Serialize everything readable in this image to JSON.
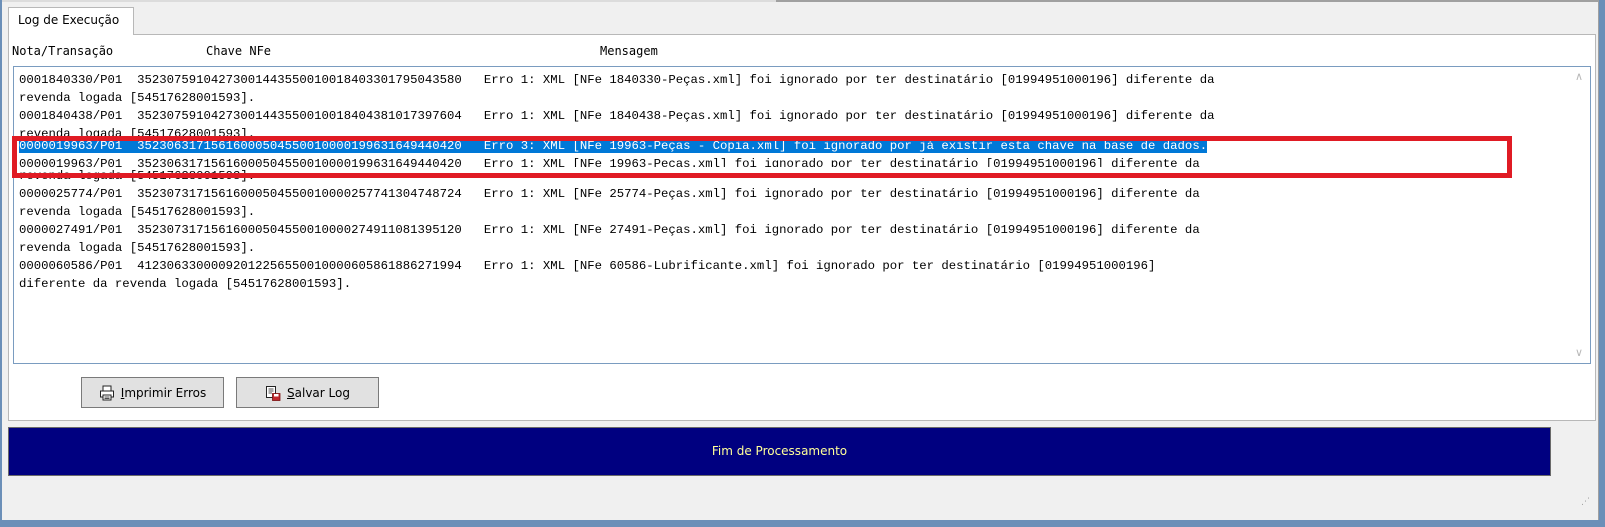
{
  "tab": {
    "label": "Log de Execução"
  },
  "columns": {
    "nota": "Nota/Transação",
    "chave": "Chave NFe",
    "mensagem": "Mensagem"
  },
  "log": {
    "lines": [
      {
        "text": "0001840330/P01  35230759104273001443550010018403301795043580   Erro 1: XML [NFe 1840330-Peças.xml] foi ignorado por ter destinatário [01994951000196] diferente da"
      },
      {
        "text": "revenda logada [54517628001593]."
      },
      {
        "text": "0001840438/P01  35230759104273001443550010018404381017397604   Erro 1: XML [NFe 1840438-Peças.xml] foi ignorado por ter destinatário [01994951000196] diferente da"
      },
      {
        "text": "revenda logada [54517628001593]."
      },
      {
        "text": "0000019963/P01  35230631715616000504550010000199631649440420   Erro 3: XML [NFe 19963-Peças - Copia.xml] foi ignorado por já existir esta chave na base de dados."
      },
      {
        "text": "0000019963/P01  35230631715616000504550010000199631649440420   Erro 1: XML [NFe 19963-Peças.xml] foi ignorado por ter destinatário [01994951000196] diferente da"
      },
      {
        "text": "revenda logada [54517628001593]."
      },
      {
        "text": "0000025774/P01  35230731715616000504550010000257741304748724   Erro 1: XML [NFe 25774-Peças.xml] foi ignorado por ter destinatário [01994951000196] diferente da"
      },
      {
        "text": "revenda logada [54517628001593]."
      },
      {
        "text": "0000027491/P01  35230731715616000504550010000274911081395120   Erro 1: XML [NFe 27491-Peças.xml] foi ignorado por ter destinatário [01994951000196] diferente da"
      },
      {
        "text": "revenda logada [54517628001593]."
      },
      {
        "text": "0000060586/P01  41230633000092012256550010000605861886271994   Erro 1: XML [NFe 60586-Lubrificante.xml] foi ignorado por ter destinatário [01994951000196]"
      },
      {
        "text": "diferente da revenda logada [54517628001593]."
      }
    ],
    "selected_index": 4
  },
  "buttons": {
    "print_label_prefix": "",
    "print_mnemonic": "I",
    "print_label_rest": "mprimir Erros",
    "save_mnemonic": "S",
    "save_label_rest": "alvar Log"
  },
  "status": {
    "text": "Fim de Processamento"
  },
  "icons": {
    "print": "printer-icon",
    "save": "save-log-icon",
    "scroll_up": "chevron-up-icon",
    "scroll_down": "chevron-down-icon"
  },
  "colors": {
    "selection": "#0078d7",
    "status_bg": "#000080",
    "status_text": "#ffff99",
    "highlight_box": "#e01b24"
  }
}
